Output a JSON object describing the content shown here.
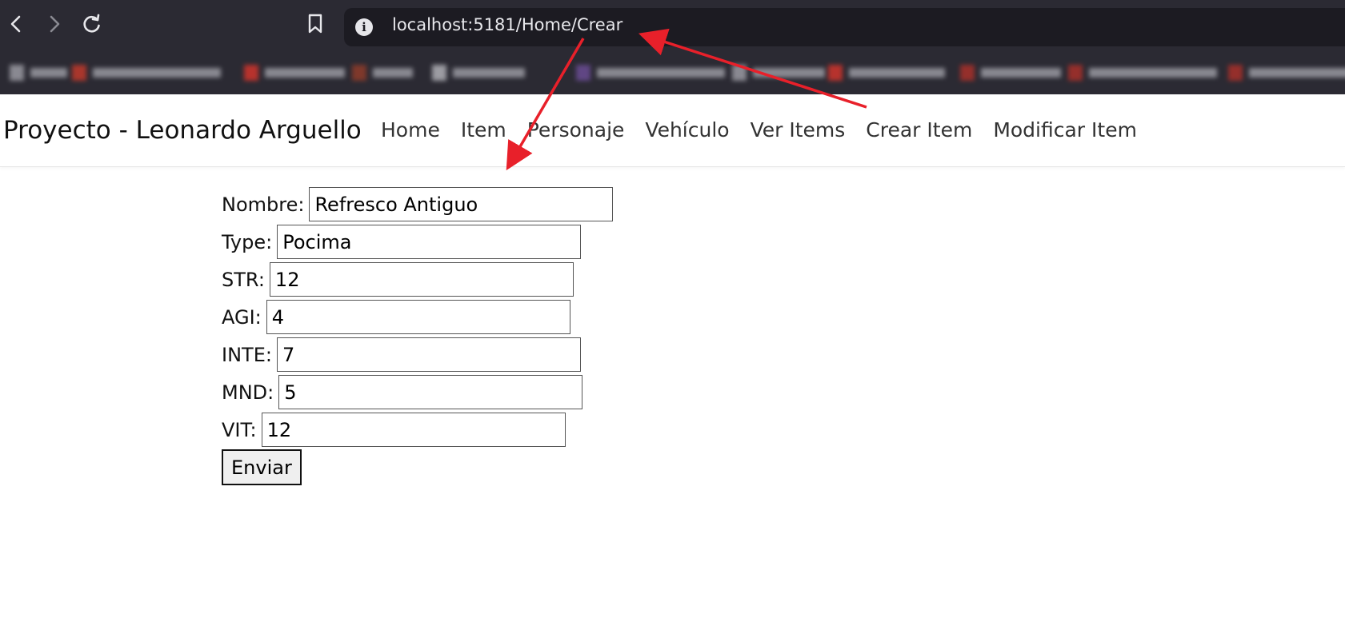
{
  "browser": {
    "url": "localhost:5181/Home/Crear",
    "icons": [
      "back-icon",
      "forward-icon",
      "reload-icon",
      "bookmark-icon",
      "info-icon"
    ]
  },
  "site": {
    "brand": "Proyecto - Leonardo Arguello",
    "nav": [
      "Home",
      "Item",
      "Personaje",
      "Vehículo",
      "Ver Items",
      "Crear Item",
      "Modificar Item"
    ]
  },
  "form": {
    "fields": [
      {
        "label": "Nombre:",
        "value": "Refresco Antiguo"
      },
      {
        "label": "Type:",
        "value": "Pocima"
      },
      {
        "label": "STR:",
        "value": "12"
      },
      {
        "label": "AGI:",
        "value": "4"
      },
      {
        "label": "INTE:",
        "value": "7"
      },
      {
        "label": "MND:",
        "value": "5"
      },
      {
        "label": "VIT:",
        "value": "12"
      }
    ],
    "submit_label": "Enviar"
  },
  "colors": {
    "browser_chrome": "#2b2a33",
    "url_bar": "#1c1b22",
    "annotation_arrow": "#e8202a"
  }
}
